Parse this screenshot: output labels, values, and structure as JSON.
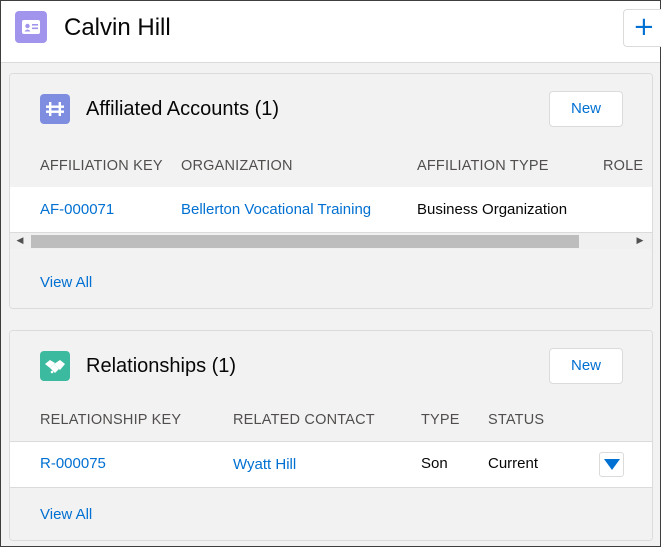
{
  "header": {
    "title": "Calvin Hill",
    "add_label": "+",
    "icon_color": "#a094ed"
  },
  "affiliations": {
    "title": "Affiliated Accounts (1)",
    "new_label": "New",
    "icon_color": "#7f8de1",
    "columns": [
      "AFFILIATION KEY",
      "ORGANIZATION",
      "AFFILIATION TYPE",
      "ROLE"
    ],
    "rows": [
      {
        "key": "AF-000071",
        "organization": "Bellerton Vocational Training",
        "type": "Business Organization",
        "role": ""
      }
    ],
    "view_all": "View All"
  },
  "relationships": {
    "title": "Relationships (1)",
    "new_label": "New",
    "icon_color": "#3bba9f",
    "columns": [
      "RELATIONSHIP KEY",
      "RELATED CONTACT",
      "TYPE",
      "STATUS"
    ],
    "rows": [
      {
        "key": "R-000075",
        "contact": "Wyatt Hill",
        "type": "Son",
        "status": "Current"
      }
    ],
    "view_all": "View All"
  }
}
